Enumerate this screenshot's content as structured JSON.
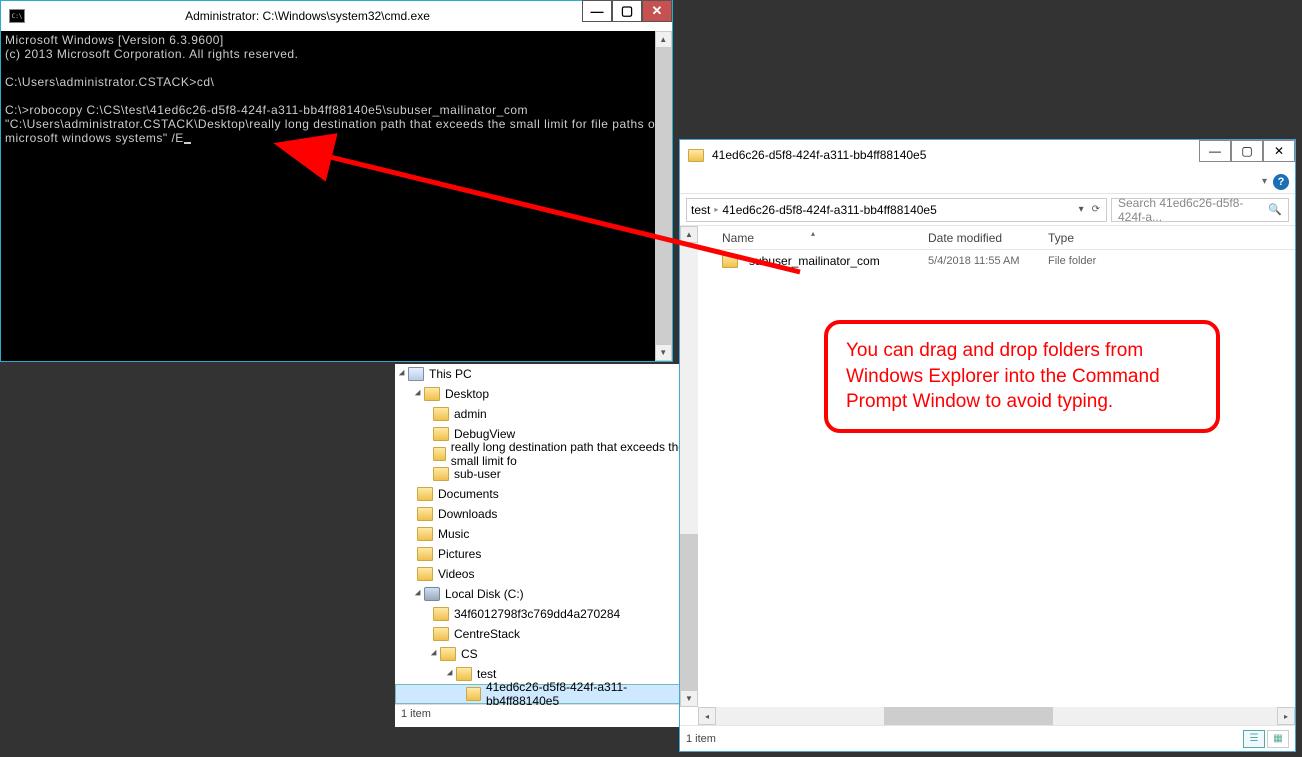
{
  "cmd": {
    "title": "Administrator: C:\\Windows\\system32\\cmd.exe",
    "line1": "Microsoft Windows [Version 6.3.9600]",
    "line2": "(c) 2013 Microsoft Corporation. All rights reserved.",
    "line3": "C:\\Users\\administrator.CSTACK>cd\\",
    "line4": "C:\\>robocopy C:\\CS\\test\\41ed6c26-d5f8-424f-a311-bb4ff88140e5\\subuser_mailinator_com \"C:\\Users\\administrator.CSTACK\\Desktop\\really long destination path that exceeds the small limit for file paths on microsoft windows systems\" /E"
  },
  "bg_tree": {
    "pc": "This PC",
    "desktop": "Desktop",
    "admin": "admin",
    "debugview": "DebugView",
    "longpath": "really long destination path that exceeds the small limit fo",
    "subuser": "sub-user",
    "documents": "Documents",
    "downloads": "Downloads",
    "music": "Music",
    "pictures": "Pictures",
    "videos": "Videos",
    "localdisk": "Local Disk (C:)",
    "hash1": "34f6012798f3c769dd4a270284",
    "centrestack": "CentreStack",
    "cs": "CS",
    "test": "test",
    "guid": "41ed6c26-d5f8-424f-a311-bb4ff88140e5",
    "status": "1 item"
  },
  "explorer": {
    "title": "41ed6c26-d5f8-424f-a311-bb4ff88140e5",
    "crumb_test": "test",
    "crumb_guid": "41ed6c26-d5f8-424f-a311-bb4ff88140e5",
    "search_placeholder": "Search 41ed6c26-d5f8-424f-a...",
    "col_name": "Name",
    "col_date": "Date modified",
    "col_type": "Type",
    "row1": {
      "name": "subuser_mailinator_com",
      "date": "5/4/2018 11:55 AM",
      "type": "File folder"
    },
    "status": "1 item"
  },
  "callout": {
    "text": "You can drag and drop folders from Windows Explorer into the Command Prompt Window to avoid typing."
  }
}
